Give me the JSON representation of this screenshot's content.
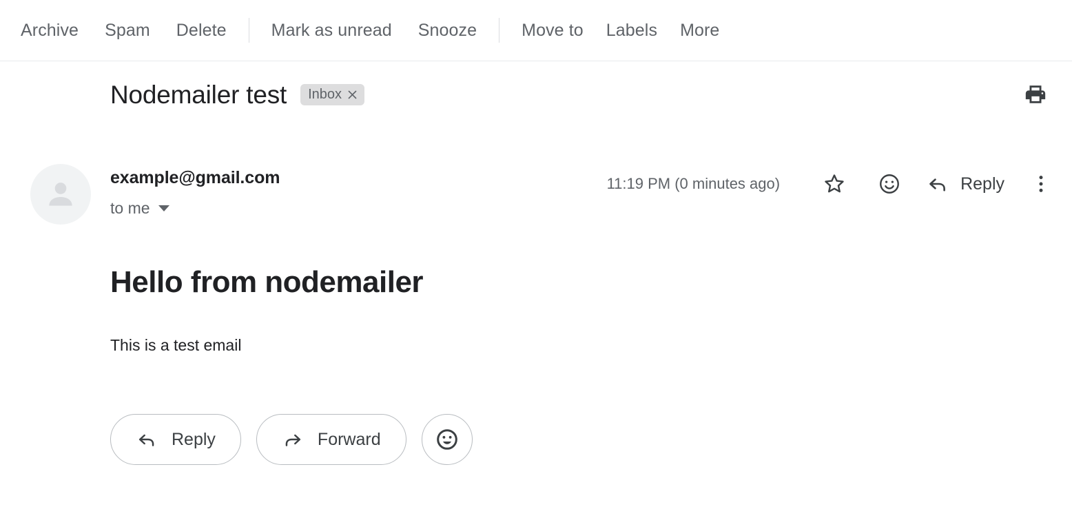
{
  "toolbar": {
    "group1": [
      {
        "label": "Archive",
        "name": "archive"
      },
      {
        "label": "Spam",
        "name": "spam"
      },
      {
        "label": "Delete",
        "name": "delete"
      }
    ],
    "group2": [
      {
        "label": "Mark as unread",
        "name": "mark-as-unread"
      },
      {
        "label": "Snooze",
        "name": "snooze"
      }
    ],
    "group3": [
      {
        "label": "Move to",
        "name": "move-to"
      },
      {
        "label": "Labels",
        "name": "labels"
      },
      {
        "label": "More",
        "name": "more"
      }
    ]
  },
  "subject": {
    "title": "Nodemailer test",
    "chip_label": "Inbox",
    "chip_remove_icon": "close-icon",
    "print_icon": "print-icon"
  },
  "message": {
    "sender": "example@gmail.com",
    "recipient": "to me",
    "recipient_caret_icon": "chevron-down-icon",
    "timestamp": "11:19 PM (0 minutes ago)",
    "avatar_icon": "person-icon",
    "star_icon": "star-outline-icon",
    "emoji_icon": "smiley-outline-icon",
    "reply_icon": "reply-arrow-icon",
    "reply_label": "Reply",
    "more_icon": "more-vert-icon",
    "heading": "Hello from nodemailer",
    "body": "This is a test email"
  },
  "actions": {
    "reply": {
      "label": "Reply",
      "icon": "reply-arrow-icon"
    },
    "forward": {
      "label": "Forward",
      "icon": "forward-arrow-icon"
    },
    "emoji": {
      "icon": "smiley-outline-icon"
    }
  },
  "colors": {
    "text_primary": "#202124",
    "text_secondary": "#5f6368",
    "chip_bg": "#ddddde",
    "avatar_bg": "#f1f3f4",
    "border": "#dadce0"
  }
}
